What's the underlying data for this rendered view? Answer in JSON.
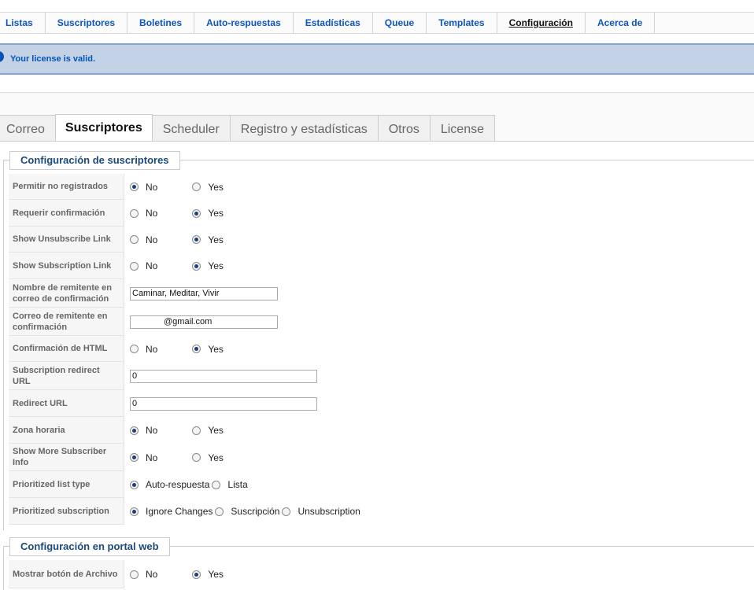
{
  "menu": [
    "Listas",
    "Suscriptores",
    "Boletines",
    "Auto-respuestas",
    "Estadísticas",
    "Queue",
    "Templates",
    "Configuración",
    "Acerca de"
  ],
  "menu_active": 7,
  "message": "Your license is valid.",
  "tabs": [
    "Correo",
    "Suscriptores",
    "Scheduler",
    "Registro y estadísticas",
    "Otros",
    "License"
  ],
  "tabs_active": 1,
  "sections": {
    "subscribers": {
      "legend": "Configuración de suscriptores",
      "rows": [
        {
          "label": "Permitir no registrados",
          "type": "radio",
          "options": [
            "No",
            "Yes"
          ],
          "selected": 0
        },
        {
          "label": "Requerir confirmación",
          "type": "radio",
          "options": [
            "No",
            "Yes"
          ],
          "selected": 1
        },
        {
          "label": "Show Unsubscribe Link",
          "type": "radio",
          "options": [
            "No",
            "Yes"
          ],
          "selected": 1
        },
        {
          "label": "Show Subscription Link",
          "type": "radio",
          "options": [
            "No",
            "Yes"
          ],
          "selected": 1
        },
        {
          "label": "Nombre de remitente en correo de confirmación",
          "type": "text",
          "value": "Caminar, Meditar, Vivir"
        },
        {
          "label": "Correo de remitente en confirmación",
          "type": "text",
          "value": "@gmail.com"
        },
        {
          "label": "Confirmación de HTML",
          "type": "radio",
          "options": [
            "No",
            "Yes"
          ],
          "selected": 1
        },
        {
          "label": "Subscription redirect URL",
          "type": "text",
          "value": "0"
        },
        {
          "label": "Redirect URL",
          "type": "text",
          "value": "0"
        },
        {
          "label": "Zona horaria",
          "type": "radio",
          "options": [
            "No",
            "Yes"
          ],
          "selected": 0
        },
        {
          "label": "Show More Subscriber Info",
          "type": "radio",
          "options": [
            "No",
            "Yes"
          ],
          "selected": 0
        },
        {
          "label": "Prioritized list type",
          "type": "radio",
          "options": [
            "Auto-respuesta",
            "Lista"
          ],
          "selected": 0
        },
        {
          "label": "Prioritized subscription",
          "type": "radio",
          "options": [
            "Ignore Changes",
            "Suscripción",
            "Unsubscription"
          ],
          "selected": 0
        }
      ]
    },
    "portal": {
      "legend": "Configuración en portal web",
      "rows": [
        {
          "label": "Mostrar botón de Archivo",
          "type": "radio",
          "options": [
            "No",
            "Yes"
          ],
          "selected": 1
        }
      ]
    }
  }
}
